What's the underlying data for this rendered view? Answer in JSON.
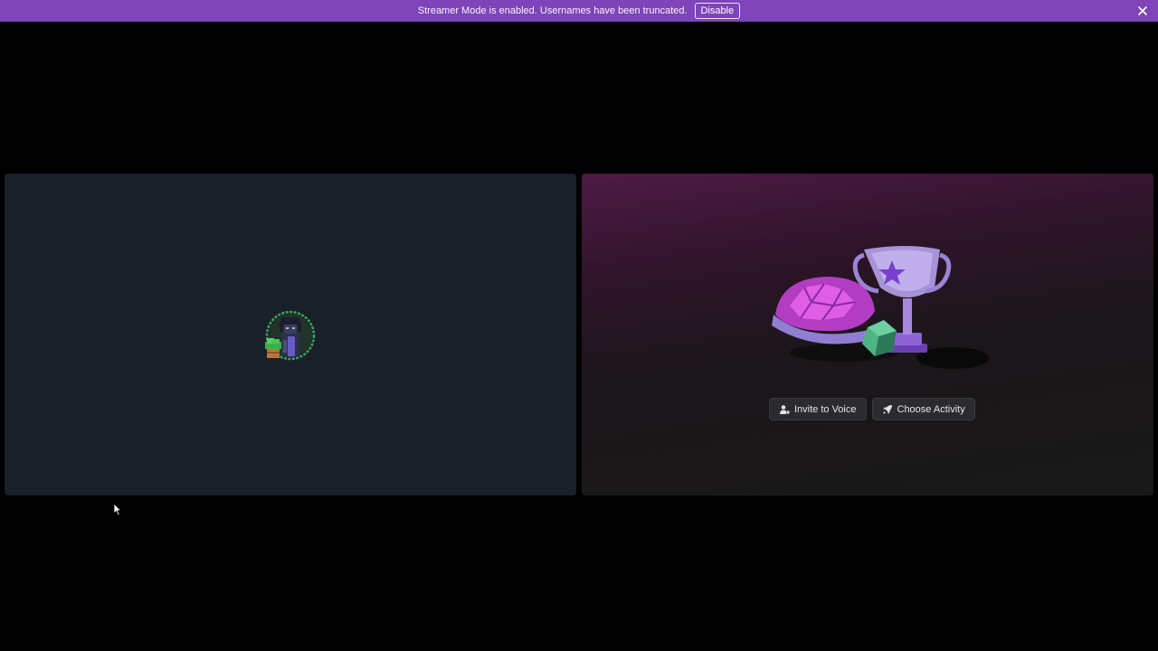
{
  "banner": {
    "message": "Streamer Mode is enabled. Usernames have been truncated.",
    "disable_label": "Disable",
    "close_icon": "close-icon",
    "background": "#7e44b8"
  },
  "participants": [
    {
      "tile": "user-video-tile",
      "avatar_icon": "pixel-avatar-icon",
      "speaking_ring_color": "#3ba55c"
    }
  ],
  "activity_panel": {
    "illustration_icon": "trophy-shell-dice-icon",
    "buttons": {
      "invite_label": "Invite to Voice",
      "invite_icon": "person-add-icon",
      "activity_label": "Choose Activity",
      "activity_icon": "rocket-icon"
    }
  }
}
